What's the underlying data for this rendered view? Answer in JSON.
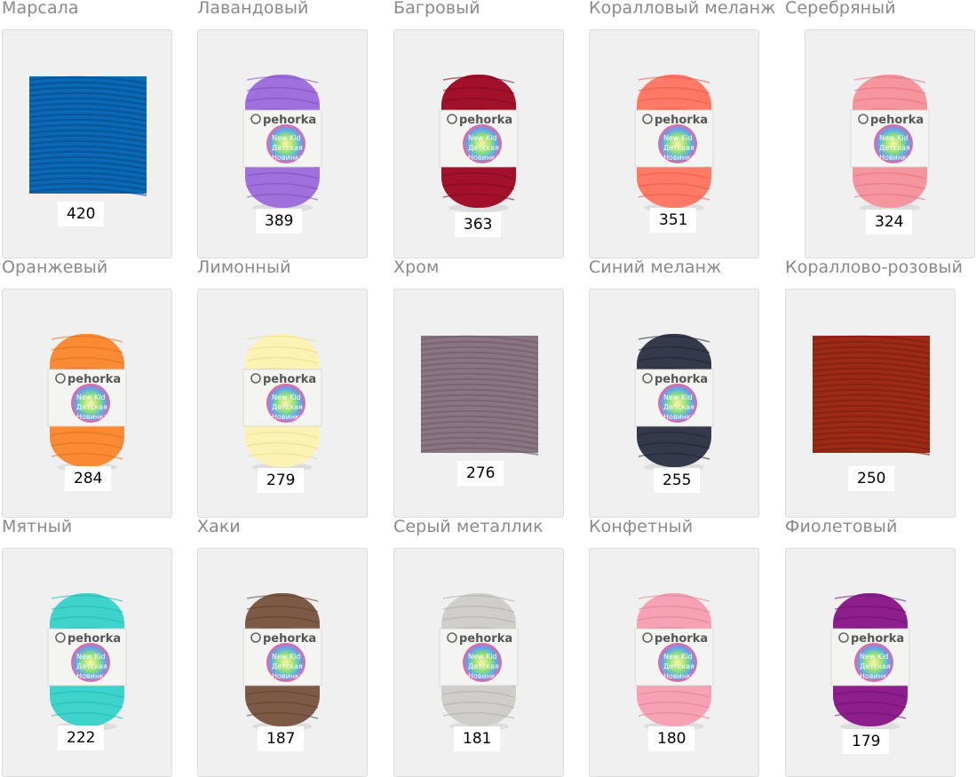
{
  "brand": "pehorka",
  "label_lines": [
    "New Kid",
    "Детская",
    "Новинка"
  ],
  "swatches": [
    {
      "name": "Марсала",
      "code": "420",
      "kind": "swatch",
      "color": "#0a68b4",
      "dark": "#064a86"
    },
    {
      "name": "Лавандовый",
      "code": "389",
      "kind": "ball",
      "color": "#a070dc",
      "dark": "#7a4cc0"
    },
    {
      "name": "Багровый",
      "code": "363",
      "kind": "ball",
      "color": "#a2102a",
      "dark": "#780a1c"
    },
    {
      "name": "Коралловый меланж",
      "code": "351",
      "kind": "ball",
      "color": "#ff7a66",
      "dark": "#e85545"
    },
    {
      "name": "Серебряный",
      "code": "324",
      "kind": "ball",
      "color": "#f5969e",
      "dark": "#e0707a"
    },
    {
      "name": "Оранжевый",
      "code": "284",
      "kind": "ball",
      "color": "#fb8a34",
      "dark": "#e06a18"
    },
    {
      "name": "Лимонный",
      "code": "279",
      "kind": "ball",
      "color": "#fbf2b4",
      "dark": "#e8dc8c"
    },
    {
      "name": "Хром",
      "code": "276",
      "kind": "swatch",
      "color": "#8a7682",
      "dark": "#6c5a66"
    },
    {
      "name": "Синий меланж",
      "code": "255",
      "kind": "ball",
      "color": "#343a4c",
      "dark": "#1e2230"
    },
    {
      "name": "Кораллово-розовый",
      "code": "250",
      "kind": "swatch",
      "color": "#9c2a16",
      "dark": "#7a1e0e"
    },
    {
      "name": "Мятный",
      "code": "222",
      "kind": "ball",
      "color": "#3ed4cc",
      "dark": "#22b4ac"
    },
    {
      "name": "Хаки",
      "code": "187",
      "kind": "ball",
      "color": "#7c5a46",
      "dark": "#5a3e2e"
    },
    {
      "name": "Серый металлик",
      "code": "181",
      "kind": "ball",
      "color": "#d0ceca",
      "dark": "#aeaca8"
    },
    {
      "name": "Конфетный",
      "code": "180",
      "kind": "ball",
      "color": "#f6a2b4",
      "dark": "#e07e94"
    },
    {
      "name": "Фиолетовый",
      "code": "179",
      "kind": "ball",
      "color": "#8e1e8c",
      "dark": "#6a106a"
    }
  ]
}
